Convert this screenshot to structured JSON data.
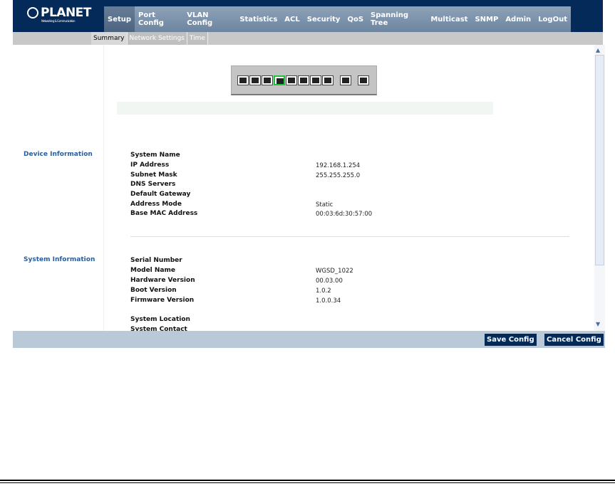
{
  "brand": {
    "name": "PLANET",
    "tagline": "Networking & Communication"
  },
  "menu": [
    "Setup",
    "Port Config",
    "VLAN Config",
    "Statistics",
    "ACL",
    "Security",
    "QoS",
    "Spanning Tree",
    "Multicast",
    "SNMP",
    "Admin",
    "LogOut"
  ],
  "submenu": [
    "Summary",
    "Network Settings",
    "Time"
  ],
  "ports": {
    "count": 10,
    "active_port": 4,
    "active_color": "#22c040"
  },
  "device_info": {
    "title": "Device Information",
    "rows": [
      {
        "label": "System Name",
        "value": ""
      },
      {
        "label": "IP Address",
        "value": "192.168.1.254"
      },
      {
        "label": "Subnet Mask",
        "value": "255.255.255.0"
      },
      {
        "label": "DNS Servers",
        "value": ""
      },
      {
        "label": "Default Gateway",
        "value": ""
      },
      {
        "label": "Address Mode",
        "value": "Static"
      },
      {
        "label": "Base MAC Address",
        "value": "00:03:6d:30:57:00"
      }
    ]
  },
  "system_info": {
    "title": "System Information",
    "rows": [
      {
        "label": "Serial Number",
        "value": ""
      },
      {
        "label": "Model Name",
        "value": "WGSD_1022"
      },
      {
        "label": "Hardware Version",
        "value": "00.03.00"
      },
      {
        "label": "Boot Version",
        "value": "1.0.2"
      },
      {
        "label": "Firmware Version",
        "value": "1.0.0.34"
      },
      {
        "label": "System Location",
        "value": ""
      },
      {
        "label": "System Contact",
        "value": ""
      }
    ]
  },
  "footer": {
    "save": "Save Config",
    "cancel": "Cancel Config"
  }
}
